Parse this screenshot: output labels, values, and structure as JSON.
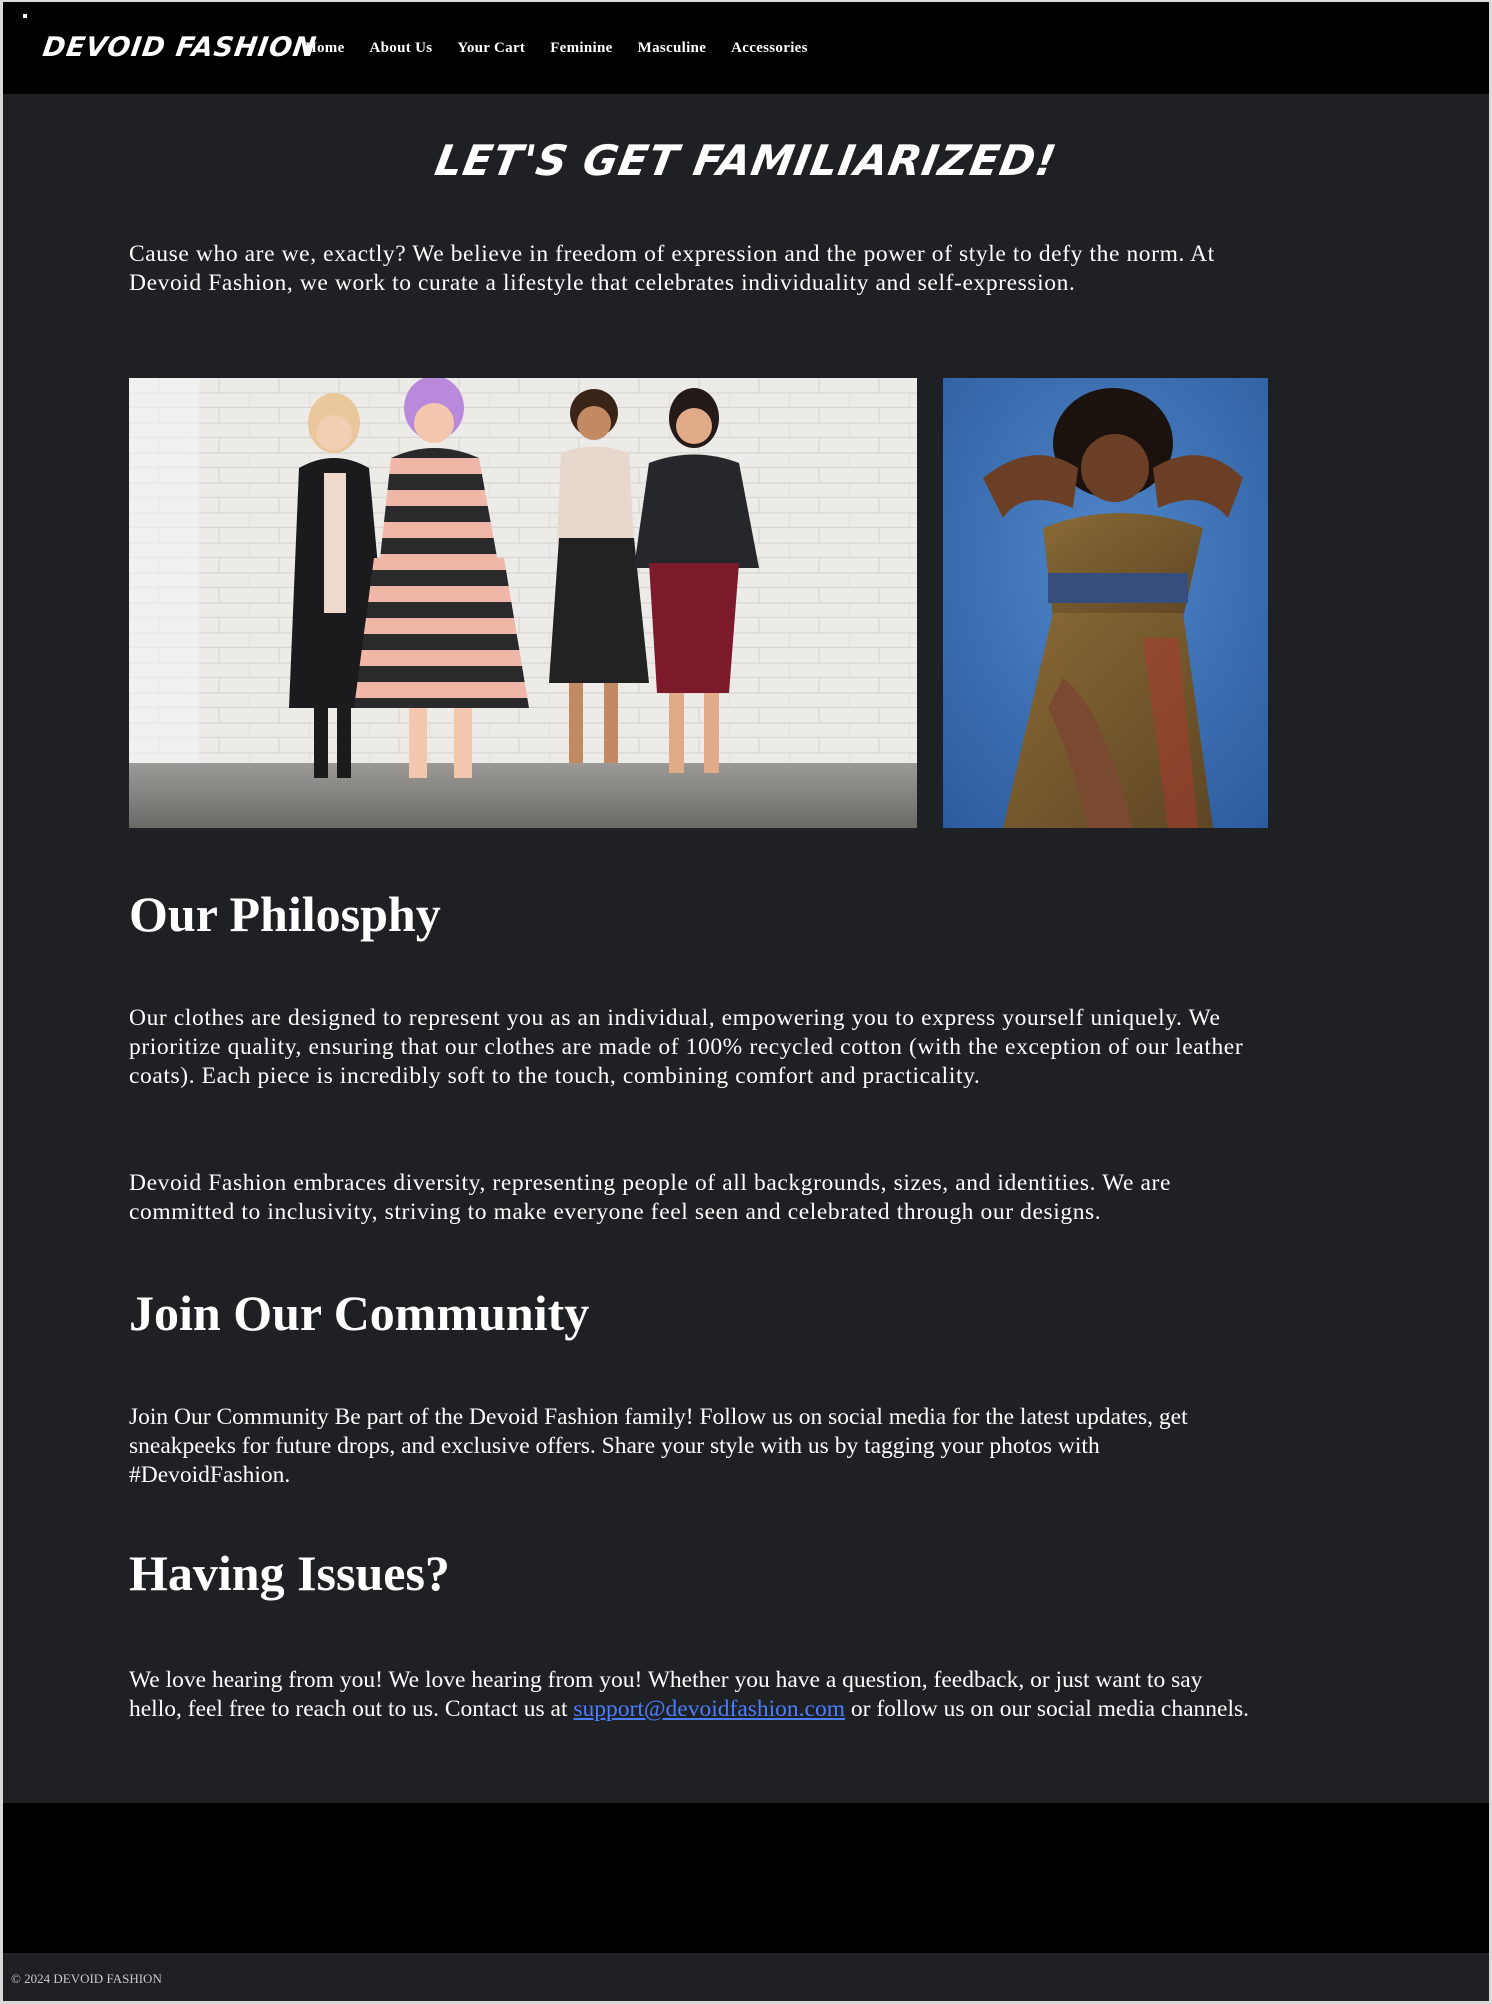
{
  "header": {
    "brand": "DEVOID FASHION",
    "nav": [
      "Home",
      "About Us",
      "Your Cart",
      "Feminine",
      "Masculine",
      "Accessories"
    ]
  },
  "main": {
    "hero_title": "LET'S GET FAMILIARIZED!",
    "intro": "Cause who are we, exactly? We believe in freedom of expression and the power of style to defy the norm. At Devoid Fashion, we work to curate a lifestyle that celebrates individuality and self-expression.",
    "philosophy": {
      "heading": "Our Philosphy",
      "p1": "Our clothes are designed to represent you as an individual, empowering you to express yourself uniquely. We prioritize quality, ensuring that our clothes are made of 100% recycled cotton (with the exception of our leather coats). Each piece is incredibly soft to the touch, combining comfort and practicality.",
      "p2": "Devoid Fashion embraces diversity, representing people of all backgrounds, sizes, and identities. We are committed to inclusivity, striving to make everyone feel seen and celebrated through our designs."
    },
    "community": {
      "heading": "Join Our Community",
      "p": "Join Our Community Be part of the Devoid Fashion family! Follow us on social media for the latest updates, get sneakpeeks for future drops, and exclusive offers. Share your style with us by tagging your photos with #DevoidFashion."
    },
    "issues": {
      "heading": "Having Issues?",
      "p_before": "We love hearing from you! We love hearing from you! Whether you have a question, feedback, or just want to say hello, feel free to reach out to us. Contact us at ",
      "email": "support@devoidfashion.com",
      "p_after": " or follow us on our social media channels."
    }
  },
  "footer": {
    "copyright": "© 2024 DEVOID FASHION"
  },
  "colors": {
    "background": "#1f2023",
    "header": "#000000",
    "link": "#4a7dff",
    "text": "#ffffff"
  }
}
